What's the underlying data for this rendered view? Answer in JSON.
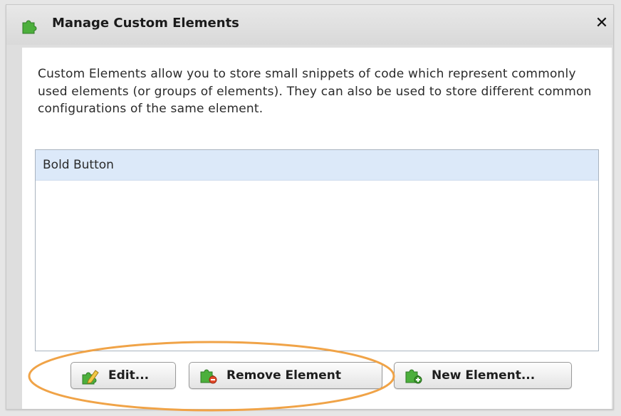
{
  "dialog": {
    "title": "Manage Custom Elements",
    "close_label": "✕"
  },
  "description": "Custom Elements allow you to store small snippets of code which represent commonly used elements (or groups of elements).  They can also be used to store different common configurations of the same element.",
  "list": {
    "items": [
      {
        "label": "Bold Button",
        "selected": true
      }
    ]
  },
  "buttons": {
    "edit": "Edit...",
    "remove": "Remove Element",
    "new": "New Element..."
  },
  "colors": {
    "selection": "#dce9f9",
    "annotation": "#f0a347",
    "puzzle_green": "#4caf3c"
  },
  "icons": [
    "puzzle-icon",
    "close-icon",
    "edit-pencil-icon",
    "remove-element-icon",
    "new-element-icon"
  ]
}
